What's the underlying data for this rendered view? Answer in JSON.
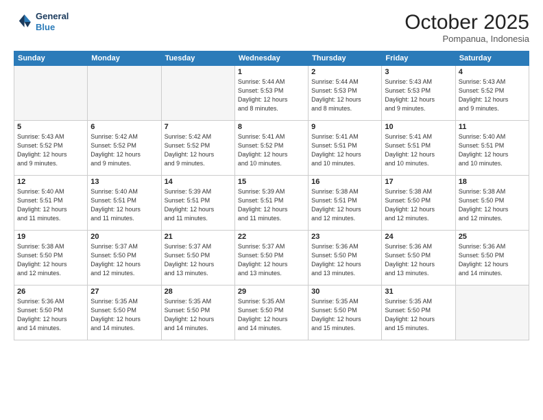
{
  "header": {
    "logo": {
      "line1": "General",
      "line2": "Blue"
    },
    "title": "October 2025",
    "subtitle": "Pompanua, Indonesia"
  },
  "weekdays": [
    "Sunday",
    "Monday",
    "Tuesday",
    "Wednesday",
    "Thursday",
    "Friday",
    "Saturday"
  ],
  "weeks": [
    [
      {
        "day": "",
        "info": ""
      },
      {
        "day": "",
        "info": ""
      },
      {
        "day": "",
        "info": ""
      },
      {
        "day": "1",
        "info": "Sunrise: 5:44 AM\nSunset: 5:53 PM\nDaylight: 12 hours\nand 8 minutes."
      },
      {
        "day": "2",
        "info": "Sunrise: 5:44 AM\nSunset: 5:53 PM\nDaylight: 12 hours\nand 8 minutes."
      },
      {
        "day": "3",
        "info": "Sunrise: 5:43 AM\nSunset: 5:53 PM\nDaylight: 12 hours\nand 9 minutes."
      },
      {
        "day": "4",
        "info": "Sunrise: 5:43 AM\nSunset: 5:52 PM\nDaylight: 12 hours\nand 9 minutes."
      }
    ],
    [
      {
        "day": "5",
        "info": "Sunrise: 5:43 AM\nSunset: 5:52 PM\nDaylight: 12 hours\nand 9 minutes."
      },
      {
        "day": "6",
        "info": "Sunrise: 5:42 AM\nSunset: 5:52 PM\nDaylight: 12 hours\nand 9 minutes."
      },
      {
        "day": "7",
        "info": "Sunrise: 5:42 AM\nSunset: 5:52 PM\nDaylight: 12 hours\nand 9 minutes."
      },
      {
        "day": "8",
        "info": "Sunrise: 5:41 AM\nSunset: 5:52 PM\nDaylight: 12 hours\nand 10 minutes."
      },
      {
        "day": "9",
        "info": "Sunrise: 5:41 AM\nSunset: 5:51 PM\nDaylight: 12 hours\nand 10 minutes."
      },
      {
        "day": "10",
        "info": "Sunrise: 5:41 AM\nSunset: 5:51 PM\nDaylight: 12 hours\nand 10 minutes."
      },
      {
        "day": "11",
        "info": "Sunrise: 5:40 AM\nSunset: 5:51 PM\nDaylight: 12 hours\nand 10 minutes."
      }
    ],
    [
      {
        "day": "12",
        "info": "Sunrise: 5:40 AM\nSunset: 5:51 PM\nDaylight: 12 hours\nand 11 minutes."
      },
      {
        "day": "13",
        "info": "Sunrise: 5:40 AM\nSunset: 5:51 PM\nDaylight: 12 hours\nand 11 minutes."
      },
      {
        "day": "14",
        "info": "Sunrise: 5:39 AM\nSunset: 5:51 PM\nDaylight: 12 hours\nand 11 minutes."
      },
      {
        "day": "15",
        "info": "Sunrise: 5:39 AM\nSunset: 5:51 PM\nDaylight: 12 hours\nand 11 minutes."
      },
      {
        "day": "16",
        "info": "Sunrise: 5:38 AM\nSunset: 5:51 PM\nDaylight: 12 hours\nand 12 minutes."
      },
      {
        "day": "17",
        "info": "Sunrise: 5:38 AM\nSunset: 5:50 PM\nDaylight: 12 hours\nand 12 minutes."
      },
      {
        "day": "18",
        "info": "Sunrise: 5:38 AM\nSunset: 5:50 PM\nDaylight: 12 hours\nand 12 minutes."
      }
    ],
    [
      {
        "day": "19",
        "info": "Sunrise: 5:38 AM\nSunset: 5:50 PM\nDaylight: 12 hours\nand 12 minutes."
      },
      {
        "day": "20",
        "info": "Sunrise: 5:37 AM\nSunset: 5:50 PM\nDaylight: 12 hours\nand 12 minutes."
      },
      {
        "day": "21",
        "info": "Sunrise: 5:37 AM\nSunset: 5:50 PM\nDaylight: 12 hours\nand 13 minutes."
      },
      {
        "day": "22",
        "info": "Sunrise: 5:37 AM\nSunset: 5:50 PM\nDaylight: 12 hours\nand 13 minutes."
      },
      {
        "day": "23",
        "info": "Sunrise: 5:36 AM\nSunset: 5:50 PM\nDaylight: 12 hours\nand 13 minutes."
      },
      {
        "day": "24",
        "info": "Sunrise: 5:36 AM\nSunset: 5:50 PM\nDaylight: 12 hours\nand 13 minutes."
      },
      {
        "day": "25",
        "info": "Sunrise: 5:36 AM\nSunset: 5:50 PM\nDaylight: 12 hours\nand 14 minutes."
      }
    ],
    [
      {
        "day": "26",
        "info": "Sunrise: 5:36 AM\nSunset: 5:50 PM\nDaylight: 12 hours\nand 14 minutes."
      },
      {
        "day": "27",
        "info": "Sunrise: 5:35 AM\nSunset: 5:50 PM\nDaylight: 12 hours\nand 14 minutes."
      },
      {
        "day": "28",
        "info": "Sunrise: 5:35 AM\nSunset: 5:50 PM\nDaylight: 12 hours\nand 14 minutes."
      },
      {
        "day": "29",
        "info": "Sunrise: 5:35 AM\nSunset: 5:50 PM\nDaylight: 12 hours\nand 14 minutes."
      },
      {
        "day": "30",
        "info": "Sunrise: 5:35 AM\nSunset: 5:50 PM\nDaylight: 12 hours\nand 15 minutes."
      },
      {
        "day": "31",
        "info": "Sunrise: 5:35 AM\nSunset: 5:50 PM\nDaylight: 12 hours\nand 15 minutes."
      },
      {
        "day": "",
        "info": ""
      }
    ]
  ]
}
